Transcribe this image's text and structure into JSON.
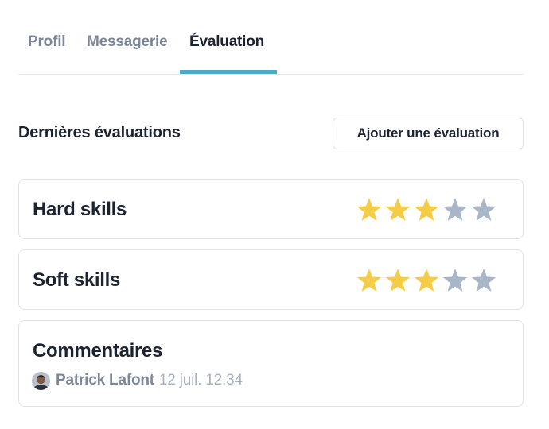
{
  "tabs": [
    {
      "label": "Profil",
      "active": false
    },
    {
      "label": "Messagerie",
      "active": false
    },
    {
      "label": "Évaluation",
      "active": true
    }
  ],
  "section": {
    "title": "Dernières évaluations",
    "add_button_label": "Ajouter une évaluation"
  },
  "ratings": [
    {
      "label": "Hard skills",
      "rating": 3,
      "max": 5
    },
    {
      "label": "Soft skills",
      "rating": 3,
      "max": 5
    }
  ],
  "comments": {
    "title": "Commentaires",
    "author": "Patrick Lafont",
    "timestamp": "12 juil. 12:34"
  },
  "colors": {
    "accent": "#4daac6",
    "star_filled": "#f5cc45",
    "star_empty": "#a9b6c7",
    "text_primary": "#1b2230",
    "text_muted": "#7b8698",
    "text_light": "#a7b0bf",
    "border": "#dfe2ea"
  }
}
